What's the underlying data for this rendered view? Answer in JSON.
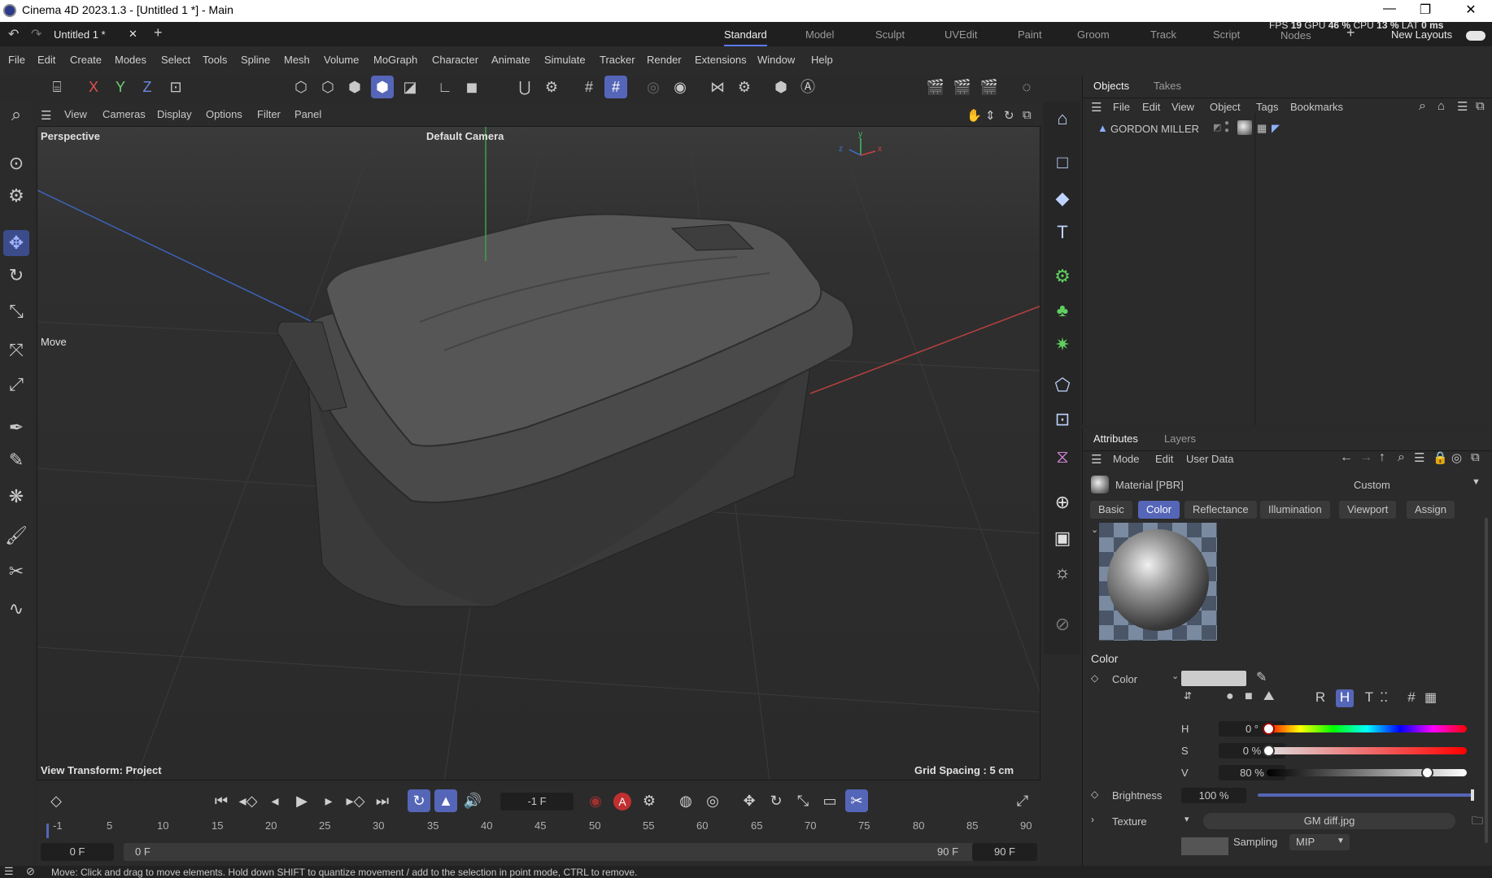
{
  "titlebar": {
    "title": "Cinema 4D 2023.1.3 - [Untitled 1 *] - Main"
  },
  "doc_tab": {
    "label": "Untitled 1 *"
  },
  "layouts": [
    "Standard",
    "Model",
    "Sculpt",
    "UVEdit",
    "Paint",
    "Groom",
    "Track",
    "Script",
    "Nodes"
  ],
  "stats": {
    "fps_label": "FPS",
    "fps": "19",
    "gpu_label": "GPU",
    "gpu": "46 %",
    "cpu_label": "CPU",
    "cpu": "13 %",
    "lat_label": "LAT",
    "lat": "0 ms"
  },
  "new_layouts": "New Layouts",
  "menu": [
    "File",
    "Edit",
    "Create",
    "Modes",
    "Select",
    "Tools",
    "Spline",
    "Mesh",
    "Volume",
    "MoGraph",
    "Character",
    "Animate",
    "Simulate",
    "Tracker",
    "Render",
    "Extensions",
    "Window",
    "Help"
  ],
  "axis_buttons": {
    "x": "X",
    "y": "Y",
    "z": "Z"
  },
  "viewport_menu": [
    "View",
    "Cameras",
    "Display",
    "Options",
    "Filter",
    "Panel"
  ],
  "viewport": {
    "projection": "Perspective",
    "camera": "Default Camera",
    "move_hint": "Move",
    "view_transform": "View Transform: Project",
    "grid_spacing": "Grid Spacing : 5 cm",
    "axis_x": "x",
    "axis_y": "y",
    "axis_z": "z"
  },
  "objects_panel": {
    "tabs": [
      "Objects",
      "Takes"
    ],
    "menu": [
      "File",
      "Edit",
      "View",
      "Object",
      "Tags",
      "Bookmarks"
    ],
    "object_name": "GORDON MILLER"
  },
  "attributes_panel": {
    "tabs": [
      "Attributes",
      "Layers"
    ],
    "menu": [
      "Mode",
      "Edit",
      "User Data"
    ],
    "material_name": "Material [PBR]",
    "preset": "Custom",
    "subtabs": [
      "Basic",
      "Color",
      "Reflectance",
      "Illumination",
      "Viewport",
      "Assign"
    ],
    "section": "Color",
    "color_label": "Color",
    "mode_letters": [
      "R",
      "H",
      "T",
      "#"
    ],
    "h_label": "H",
    "h_value": "0 °",
    "s_label": "S",
    "s_value": "0 %",
    "v_label": "V",
    "v_value": "80 %",
    "v_level": 0.8,
    "brightness_label": "Brightness",
    "brightness_value": "100 %",
    "texture_label": "Texture",
    "texture_file": "GM diff.jpg",
    "sampling_label": "Sampling",
    "sampling_value": "MIP"
  },
  "timeline": {
    "current_frame": "-1 F",
    "ticks": [
      "-1",
      "5",
      "10",
      "15",
      "20",
      "25",
      "30",
      "35",
      "40",
      "45",
      "50",
      "55",
      "60",
      "65",
      "70",
      "75",
      "80",
      "85",
      "90"
    ],
    "start_a": "0 F",
    "start_b": "0 F",
    "end_a": "90 F",
    "end_b": "90 F"
  },
  "status": {
    "text": "Move: Click and drag to move elements. Hold down SHIFT to quantize movement / add to the selection in point mode, CTRL to remove."
  },
  "colors": {
    "accent": "#5566b8",
    "x_axis": "#d04040",
    "y_axis": "#40c060",
    "z_axis": "#4070d0"
  }
}
